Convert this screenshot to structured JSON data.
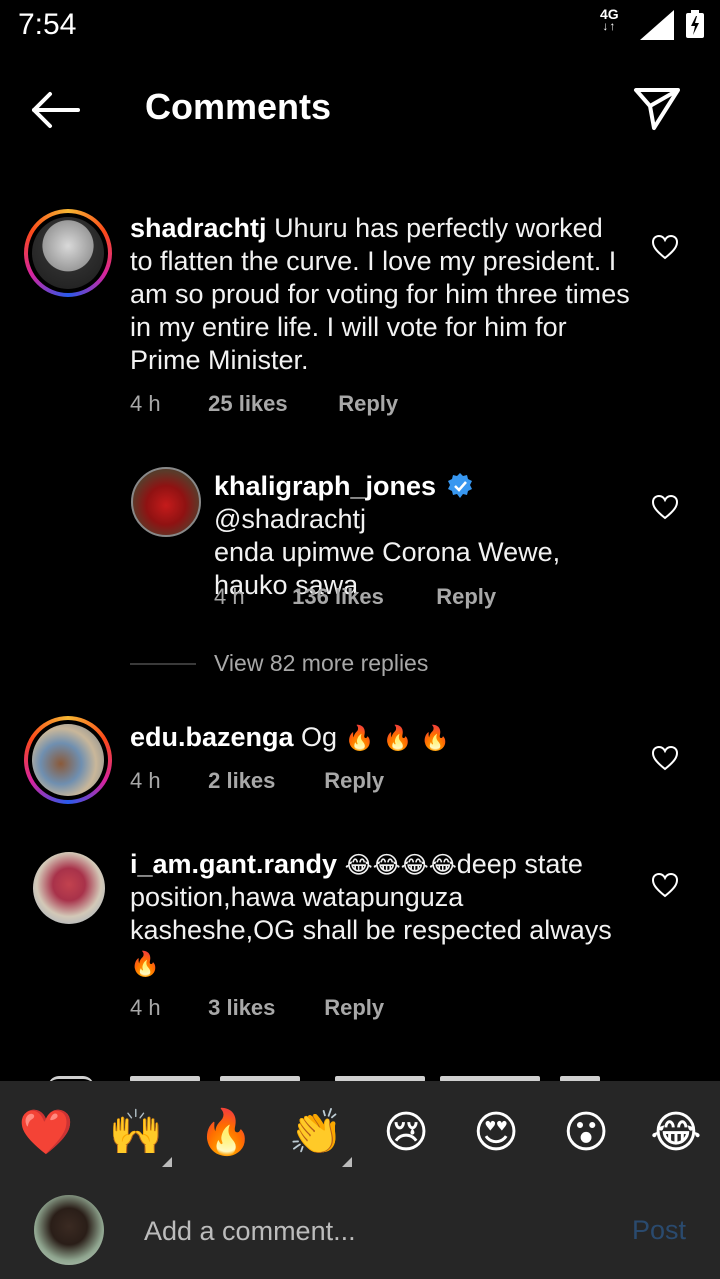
{
  "status_bar": {
    "time": "7:54",
    "network": "4G",
    "network_arrows": "↓↑"
  },
  "header": {
    "title": "Comments"
  },
  "comments": [
    {
      "username": "shadrachtj",
      "text": "Uhuru has perfectly worked to flatten the curve. I love my president. I am so proud for voting for him three times in my entire life. I will vote for him for Prime Minister.",
      "time": "4 h",
      "likes": "25 likes",
      "reply": "Reply"
    },
    {
      "username": "khaligraph_jones",
      "verified": true,
      "mention": "@shadrachtj",
      "text": "enda upimwe Corona Wewe, hauko sawa",
      "time": "4 h",
      "likes": "136 likes",
      "reply": "Reply"
    },
    {
      "username": "edu.bazenga",
      "text": "Og",
      "emoji": "🔥🔥🔥",
      "time": "4 h",
      "likes": "2 likes",
      "reply": "Reply"
    },
    {
      "username": "i_am.gant.randy",
      "emoji_lead": "😂😂😂😂",
      "text": "deep state position,hawa watapunguza kasheshe,OG shall be respected always",
      "emoji_tail": "🔥",
      "time": "4 h",
      "likes": "3 likes",
      "reply": "Reply"
    }
  ],
  "view_more_replies": "View 82 more replies",
  "quick_emojis": [
    "❤️",
    "🙌",
    "🔥",
    "👏",
    "😢",
    "😍",
    "😮",
    "😂"
  ],
  "composer": {
    "placeholder": "Add a comment...",
    "post_label": "Post"
  },
  "colors": {
    "background": "#000000",
    "bottom_bar": "#262626",
    "meta_text": "#a8a8a8",
    "post_disabled": "#2a4a6e",
    "verified_badge": "#3897f0"
  }
}
